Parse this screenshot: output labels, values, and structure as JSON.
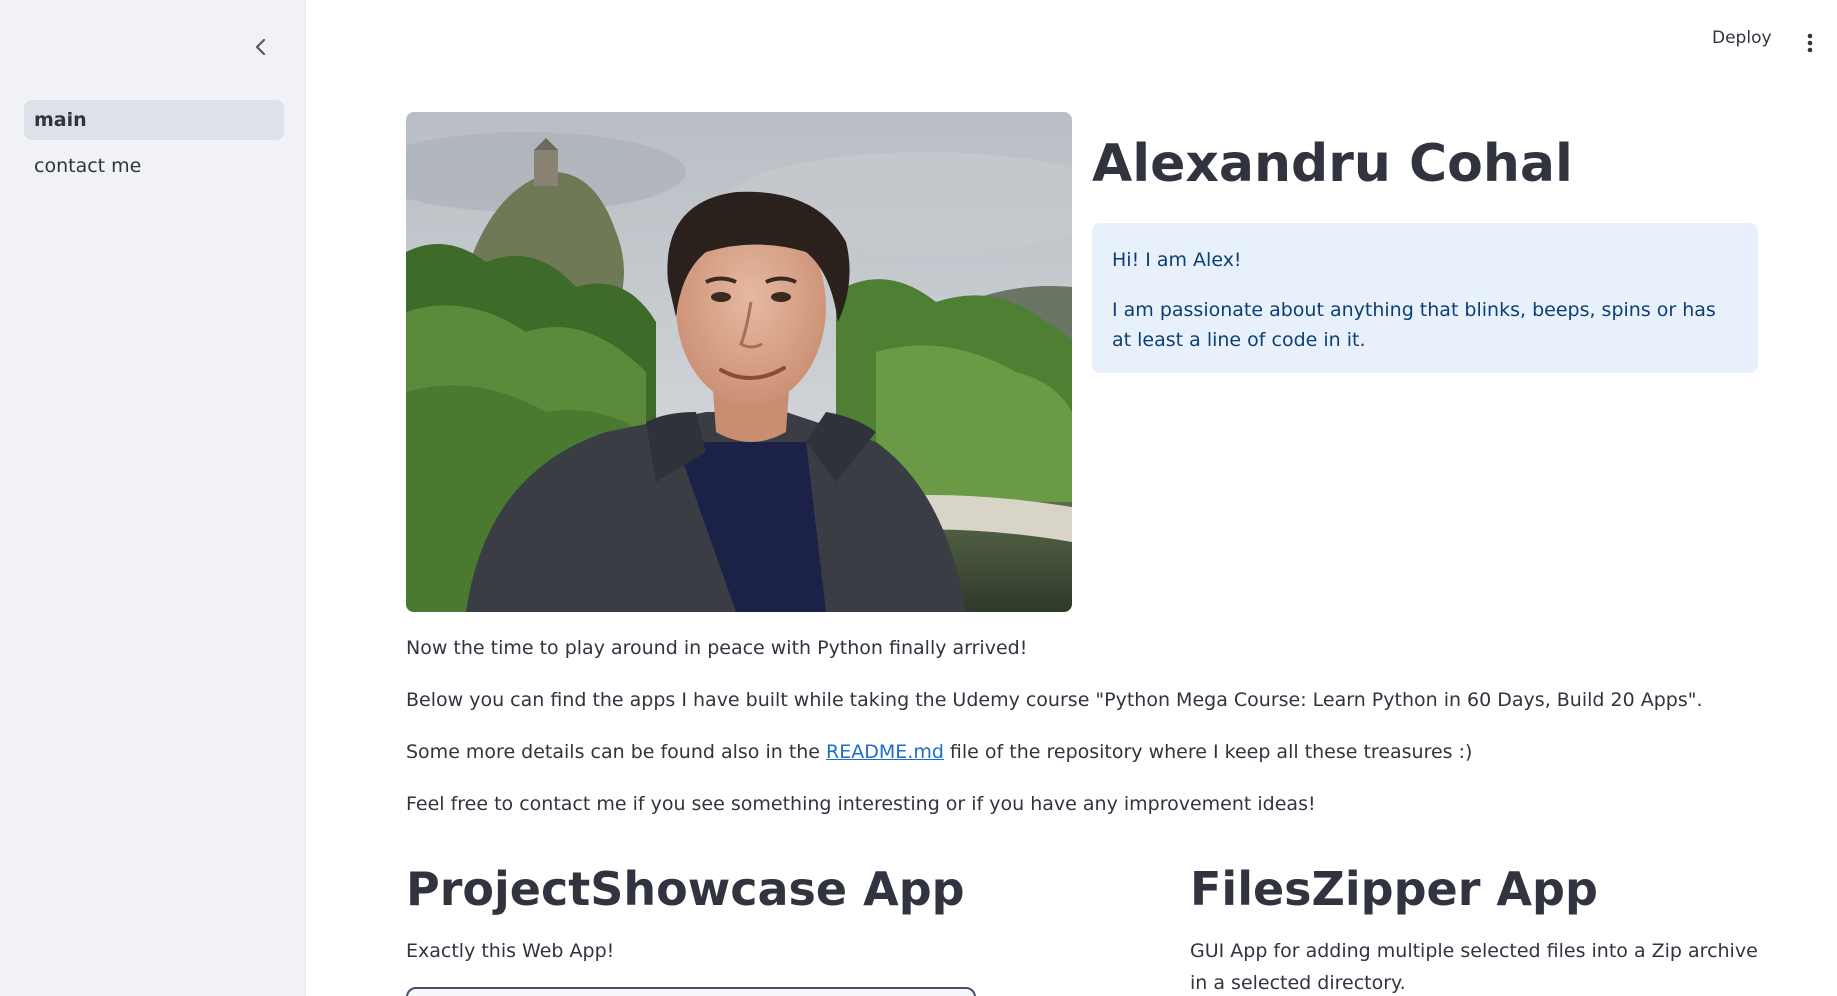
{
  "sidebar": {
    "items": [
      {
        "label": "main",
        "active": true
      },
      {
        "label": "contact me",
        "active": false
      }
    ]
  },
  "header": {
    "deploy_label": "Deploy"
  },
  "hero": {
    "name": "Alexandru Cohal",
    "intro": "Hi! I am Alex!",
    "passion": "I am passionate about anything that blinks, beeps, spins or has at least a line of code in it."
  },
  "body": {
    "p1": "Now the time to play around in peace with Python finally arrived!",
    "p2": "Below you can find the apps I have built while taking the Udemy course \"Python Mega Course: Learn Python in 60 Days, Build 20 Apps\".",
    "p3_before": "Some more details can be found also in the ",
    "p3_link": "README.md",
    "p3_after": " file of the repository where I keep all these treasures :)",
    "p4": "Feel free to contact me if you see something interesting or if you have any improvement ideas!"
  },
  "apps": [
    {
      "title": "ProjectShowcase App",
      "description": "Exactly this Web App!"
    },
    {
      "title": "FilesZipper App",
      "description": "GUI App for adding multiple selected files into a Zip archive in a selected directory."
    }
  ],
  "colors": {
    "sidebar_bg": "#f0f2f6",
    "active_item_bg": "#dde1ea",
    "info_bg": "#e8f1fb",
    "info_text": "#0d3f73",
    "link": "#1c6ec9",
    "text": "#31333f"
  }
}
